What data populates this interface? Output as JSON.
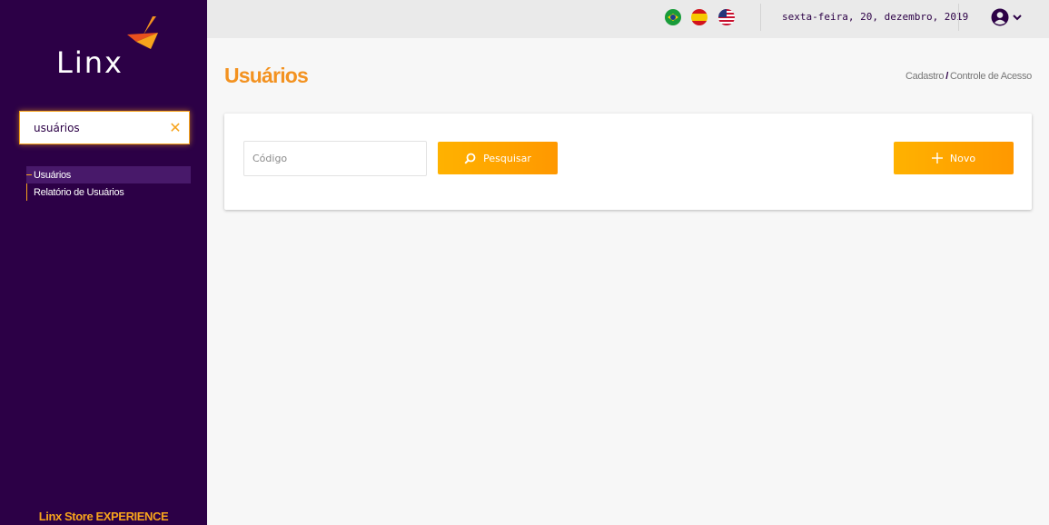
{
  "sidebar": {
    "logo_text": "Linx",
    "search_value": "usuários",
    "menu": [
      {
        "label": "Usuários",
        "active": true
      },
      {
        "label": "Relatório de Usuários",
        "active": false
      }
    ],
    "footer": "Linx Store EXPERIENCE"
  },
  "header": {
    "date": "sexta-feira, 20, dezembro, 2019"
  },
  "page": {
    "title": "Usuários",
    "breadcrumb": {
      "section": "Cadastro",
      "current": "Controle de Acesso"
    }
  },
  "form": {
    "code_placeholder": "Código",
    "search_button": "Pesquisar",
    "new_button": "Novo"
  },
  "colors": {
    "sidebar": "#2c0046",
    "accent": "#f39220",
    "button": "#ffa500"
  },
  "icons": [
    "brazil-flag-icon",
    "spain-flag-icon",
    "usa-flag-icon",
    "user-icon",
    "chevron-down-icon",
    "close-icon",
    "search-icon",
    "plus-icon"
  ]
}
